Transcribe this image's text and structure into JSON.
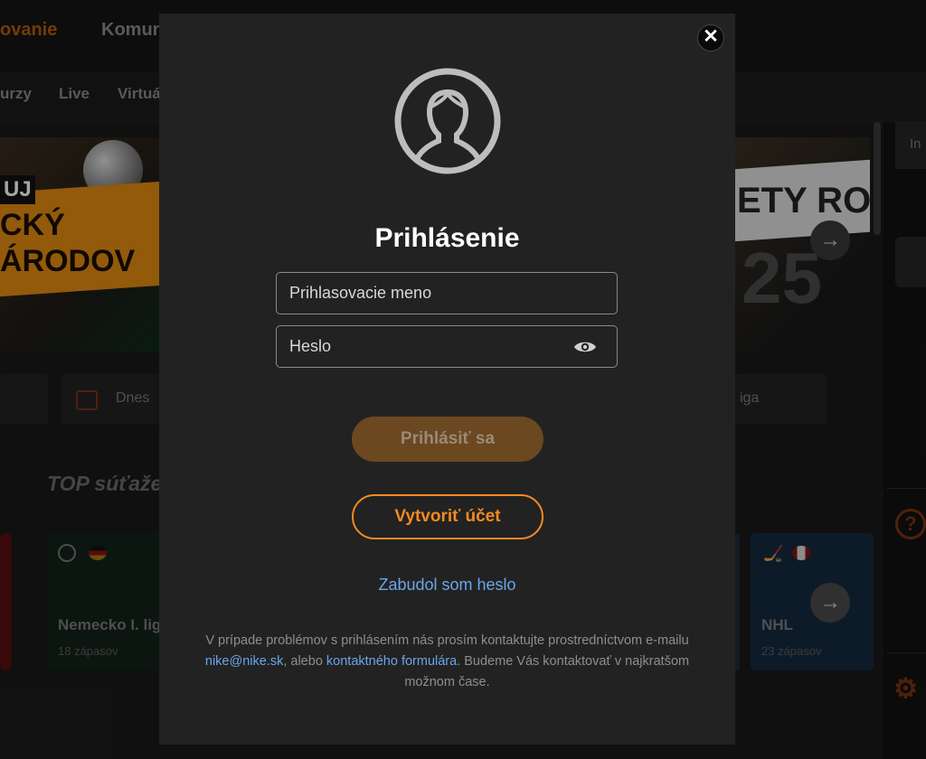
{
  "background": {
    "topnav": [
      "ovanie",
      "Komun"
    ],
    "subnav": [
      "urzy",
      "Live",
      "Virtuá"
    ],
    "banner_left": {
      "line1": "UJ",
      "line2": "CKÝ",
      "line3": "ÁRODOV"
    },
    "banner_right": {
      "text": "ETY RO",
      "year": "25"
    },
    "chips": {
      "today": "Dnes",
      "league": "iga"
    },
    "section_title": "TOP súťaže",
    "cards": [
      {
        "title": "Nemecko I. liga",
        "subtitle": "18 zápasov"
      },
      {
        "title": "NHL",
        "subtitle": "23 zápasov"
      }
    ],
    "right_tab": "In"
  },
  "modal": {
    "title": "Prihlásenie",
    "username_placeholder": "Prihlasovacie meno",
    "password_placeholder": "Heslo",
    "login_button": "Prihlásiť sa",
    "create_account_button": "Vytvoriť účet",
    "forgot_password": "Zabudol som heslo",
    "info": {
      "prefix": "V prípade problémov s prihlásením nás prosím kontaktujte prostredníctvom e-mailu ",
      "email": "nike@nike.sk",
      "middle": ", alebo ",
      "form_link": "kontaktného formulára",
      "suffix": ". Budeme Vás kontaktovať v najkratšom možnom čase."
    }
  },
  "colors": {
    "accent": "#f58b1f",
    "link": "#6aa6ea",
    "modal_bg": "#222222"
  }
}
